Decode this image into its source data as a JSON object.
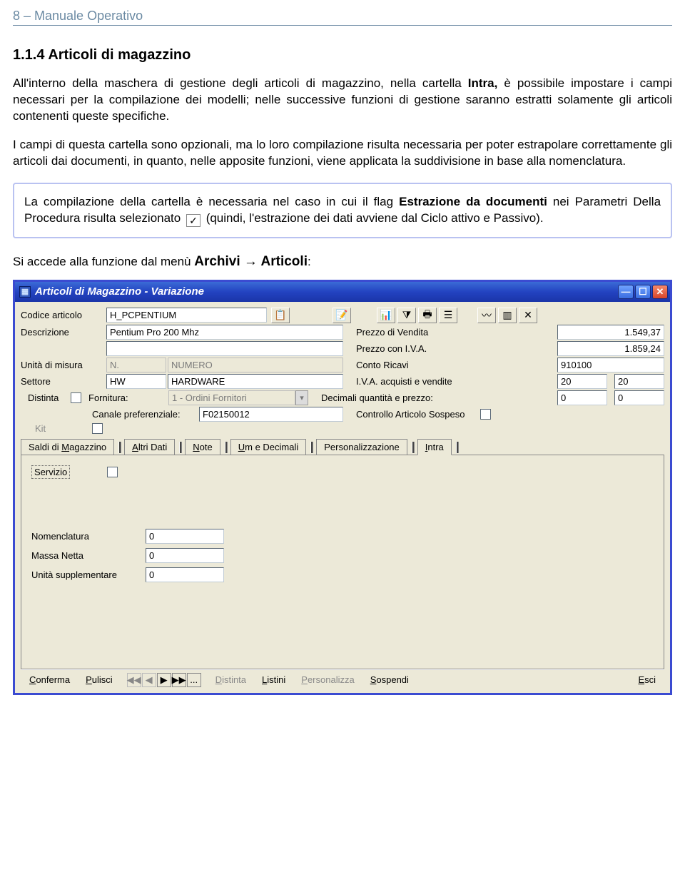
{
  "doc": {
    "header": "8  –  Manuale Operativo",
    "section_number": "1.1.4",
    "section_title": "Articoli di magazzino",
    "para1_a": "All'interno della maschera di gestione degli articoli di magazzino, nella cartella ",
    "para1_bold": "Intra,",
    "para1_b": " è possibile impostare i campi necessari per la compilazione dei modelli; nelle successive funzioni di gestione saranno estratti solamente gli articoli contenenti queste specifiche.",
    "para2": "I campi di questa cartella sono opzionali, ma lo loro compilazione risulta necessaria per poter estrapolare correttamente gli articoli dai documenti, in quanto, nelle apposite funzioni, viene applicata la suddivisione in base alla nomenclatura.",
    "callout_a": "La compilazione della cartella è necessaria nel caso in cui il flag ",
    "callout_bold": "Estrazione da documenti",
    "callout_b": " nei Parametri Della Procedura risulta selezionato ",
    "callout_check": "✓",
    "callout_c": " (quindi, l'estrazione dei dati avviene dal Ciclo attivo e Passivo).",
    "access_a": "Si accede alla funzione dal menù ",
    "access_menu1": "Archivi",
    "access_arrow": " → ",
    "access_menu2": "Articoli",
    "access_colon": ":"
  },
  "dialog": {
    "title": "Articoli di Magazzino - Variazione",
    "labels": {
      "codice": "Codice articolo",
      "descrizione": "Descrizione",
      "unita": "Unità di misura",
      "settore": "Settore",
      "distinta": "Distinta",
      "fornitura": "Fornitura:",
      "canale": "Canale preferenziale:",
      "kit": "Kit",
      "prezzo_vendita": "Prezzo di Vendita",
      "prezzo_iva": "Prezzo con I.V.A.",
      "conto_ricavi": "Conto Ricavi",
      "iva_acq": "I.V.A. acquisti e vendite",
      "dec_qp": "Decimali quantità e prezzo:",
      "controllo": "Controllo Articolo Sospeso",
      "servizio": "Servizio",
      "nomenclatura": "Nomenclatura",
      "massa": "Massa Netta",
      "unita_supp": "Unità supplementare"
    },
    "values": {
      "codice": "H_PCPENTIUM",
      "descrizione": "Pentium Pro 200 Mhz",
      "descrizione2": "",
      "um_code": "N.",
      "um_desc": "NUMERO",
      "settore_code": "HW",
      "settore_desc": "HARDWARE",
      "fornitura_sel": "1 - Ordini Fornitori",
      "canale": "F02150012",
      "prezzo_vendita": "1.549,37",
      "prezzo_iva": "1.859,24",
      "conto_ricavi": "910100",
      "iva_acq": "20",
      "iva_ven": "20",
      "dec_q": "0",
      "dec_p": "0",
      "nomenclatura": "0",
      "massa": "0",
      "unita_supp": "0"
    },
    "tabs": {
      "saldi": "Saldi di Magazzino",
      "altri": "Altri Dati",
      "note": "Note",
      "um": "Um e Decimali",
      "pers": "Personalizzazione",
      "intra": "Intra"
    },
    "bottom": {
      "conferma": "Conferma",
      "pulisci": "Pulisci",
      "distinta": "Distinta",
      "listini": "Listini",
      "personalizza": "Personalizza",
      "sospendi": "Sospendi",
      "esci": "Esci",
      "dots": "..."
    }
  }
}
